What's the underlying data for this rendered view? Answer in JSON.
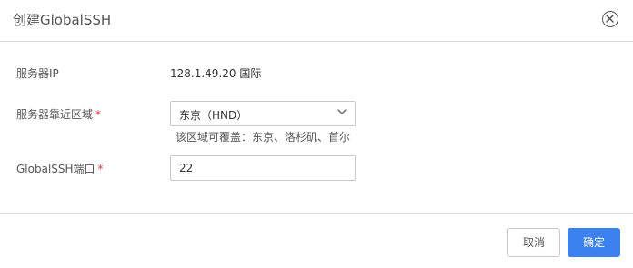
{
  "dialog": {
    "title": "创建GlobalSSH"
  },
  "form": {
    "server_ip": {
      "label": "服务器IP",
      "value": "128.1.49.20 国际"
    },
    "region": {
      "label": "服务器靠近区域",
      "required_mark": "*",
      "selected": "东京（HND）",
      "hint": "该区域可覆盖：东京、洛杉矶、首尔"
    },
    "port": {
      "label": "GlobalSSH端口",
      "required_mark": "*",
      "value": "22"
    }
  },
  "footer": {
    "cancel_label": "取消",
    "confirm_label": "确定"
  },
  "colors": {
    "primary": "#3b82f0",
    "required": "#e0393e",
    "border": "#c9c9c9"
  },
  "icons": {
    "close": "close-circle-icon",
    "dropdown": "chevron-down-icon"
  }
}
